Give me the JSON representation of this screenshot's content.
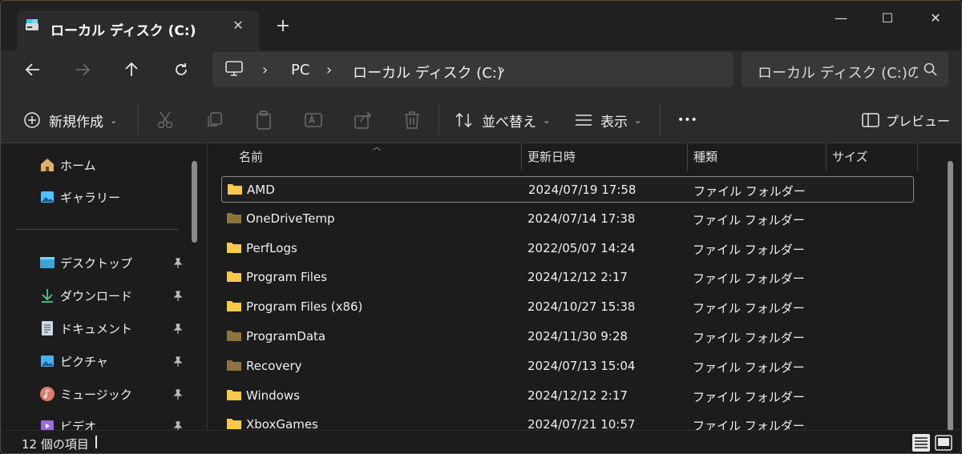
{
  "tab": {
    "title": "ローカル ディスク (C:)",
    "close_icon": "close-icon"
  },
  "window_controls": {
    "minimize": "—",
    "maximize": "☐",
    "close": "✕"
  },
  "nav": {
    "breadcrumb": [
      "PC",
      "ローカル ディスク (C:)"
    ],
    "search_placeholder": "ローカル ディスク (C:)の検索"
  },
  "toolbar": {
    "new_label": "新規作成",
    "sort_label": "並べ替え",
    "view_label": "表示",
    "more_label": "•••",
    "preview_label": "プレビュー"
  },
  "sidebar": {
    "top_items": [
      {
        "label": "ホーム",
        "icon": "home-icon"
      },
      {
        "label": "ギャラリー",
        "icon": "gallery-icon"
      }
    ],
    "pinned_items": [
      {
        "label": "デスクトップ",
        "icon": "desktop-icon"
      },
      {
        "label": "ダウンロード",
        "icon": "download-icon"
      },
      {
        "label": "ドキュメント",
        "icon": "document-icon"
      },
      {
        "label": "ピクチャ",
        "icon": "pictures-icon"
      },
      {
        "label": "ミュージック",
        "icon": "music-icon"
      },
      {
        "label": "ビデオ",
        "icon": "video-icon"
      }
    ]
  },
  "columns": [
    "名前",
    "更新日時",
    "種類",
    "サイズ"
  ],
  "files": [
    {
      "name": "AMD",
      "date": "2024/07/19 17:58",
      "type": "ファイル フォルダー",
      "size": "",
      "selected": true,
      "dim": false
    },
    {
      "name": "OneDriveTemp",
      "date": "2024/07/14 17:38",
      "type": "ファイル フォルダー",
      "size": "",
      "selected": false,
      "dim": true
    },
    {
      "name": "PerfLogs",
      "date": "2022/05/07 14:24",
      "type": "ファイル フォルダー",
      "size": "",
      "selected": false,
      "dim": false
    },
    {
      "name": "Program Files",
      "date": "2024/12/12 2:17",
      "type": "ファイル フォルダー",
      "size": "",
      "selected": false,
      "dim": false
    },
    {
      "name": "Program Files (x86)",
      "date": "2024/10/27 15:38",
      "type": "ファイル フォルダー",
      "size": "",
      "selected": false,
      "dim": false
    },
    {
      "name": "ProgramData",
      "date": "2024/11/30 9:28",
      "type": "ファイル フォルダー",
      "size": "",
      "selected": false,
      "dim": true
    },
    {
      "name": "Recovery",
      "date": "2024/07/13 15:04",
      "type": "ファイル フォルダー",
      "size": "",
      "selected": false,
      "dim": true
    },
    {
      "name": "Windows",
      "date": "2024/12/12 2:17",
      "type": "ファイル フォルダー",
      "size": "",
      "selected": false,
      "dim": false
    },
    {
      "name": "XboxGames",
      "date": "2024/07/21 10:57",
      "type": "ファイル フォルダー",
      "size": "",
      "selected": false,
      "dim": false
    }
  ],
  "status": {
    "item_count": "12 個の項目"
  },
  "colors": {
    "folder": "#f8c94a",
    "folder_dim": "#8c7440",
    "accent": "#4cc2ff"
  }
}
